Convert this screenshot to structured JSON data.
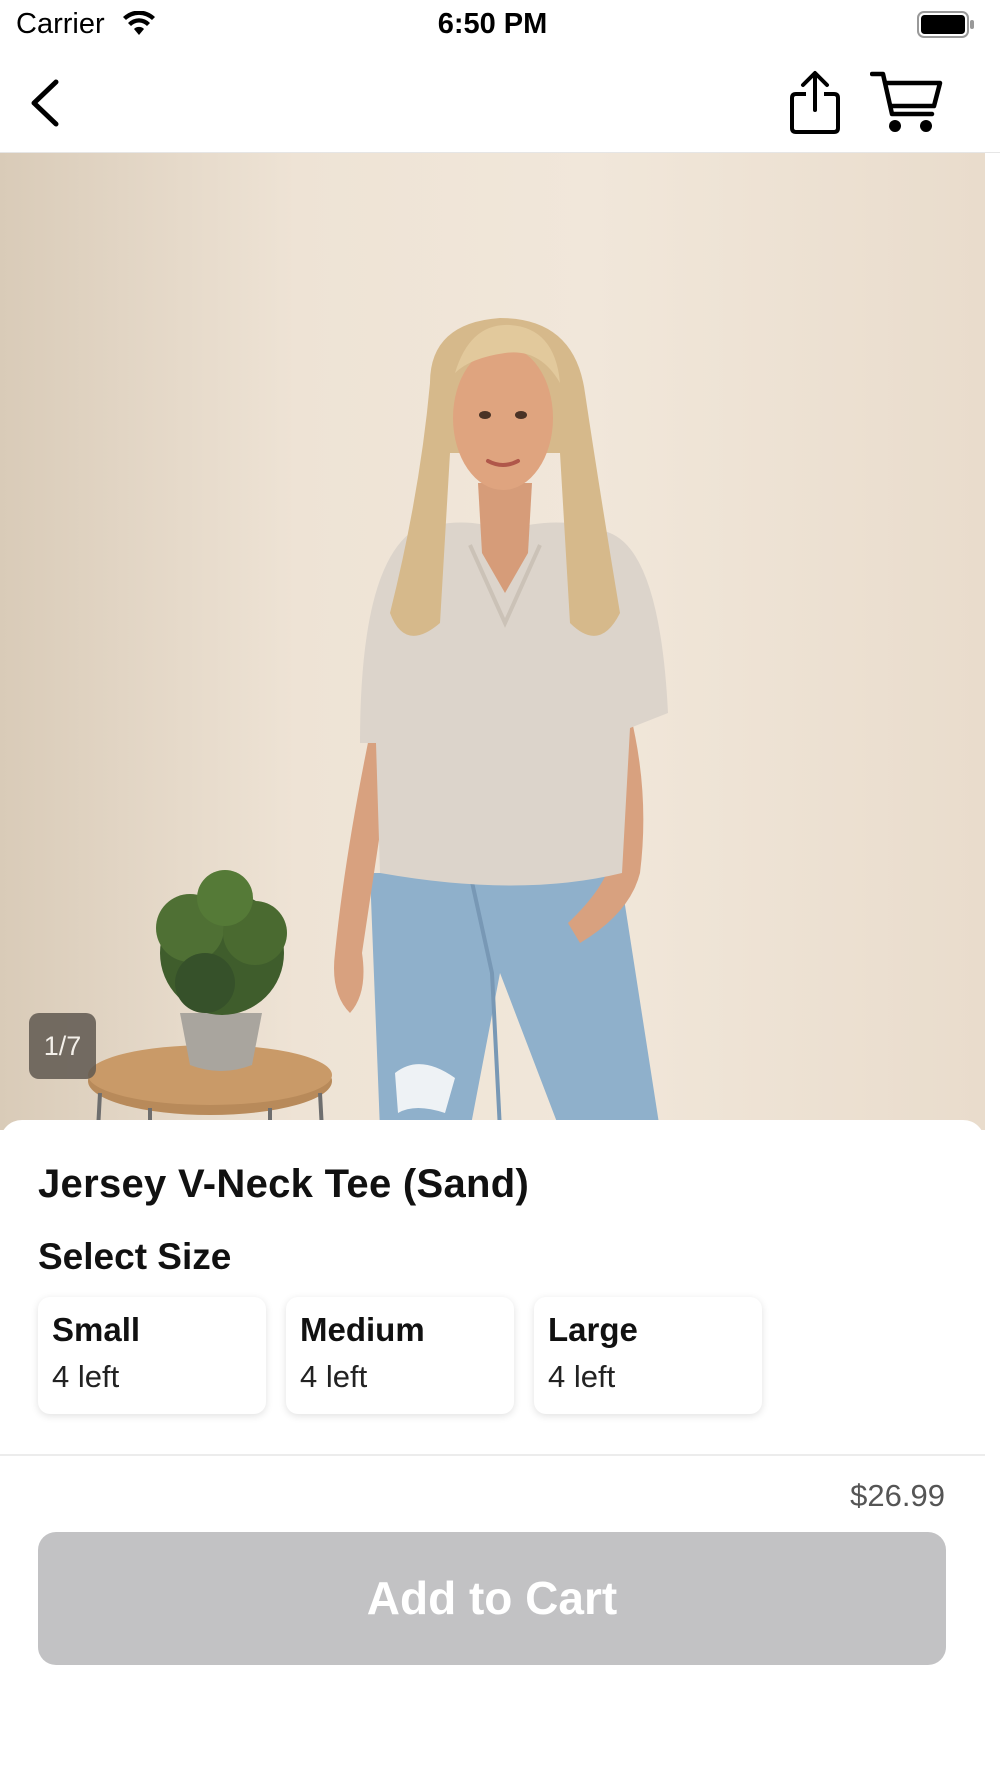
{
  "status_bar": {
    "carrier": "Carrier",
    "time": "6:50 PM"
  },
  "nav": {
    "back_icon": "chevron-left-icon",
    "share_icon": "share-icon",
    "cart_icon": "cart-icon"
  },
  "product": {
    "image_counter": "1/7",
    "title": "Jersey V-Neck Tee (Sand)",
    "size_heading": "Select Size",
    "sizes": [
      {
        "name": "Small",
        "stock": "4 left"
      },
      {
        "name": "Medium",
        "stock": "4 left"
      },
      {
        "name": "Large",
        "stock": "4 left"
      }
    ],
    "price": "$26.99",
    "add_to_cart_label": "Add to Cart"
  },
  "colors": {
    "button_disabled": "#c2c2c4",
    "background": "#ffffff"
  }
}
